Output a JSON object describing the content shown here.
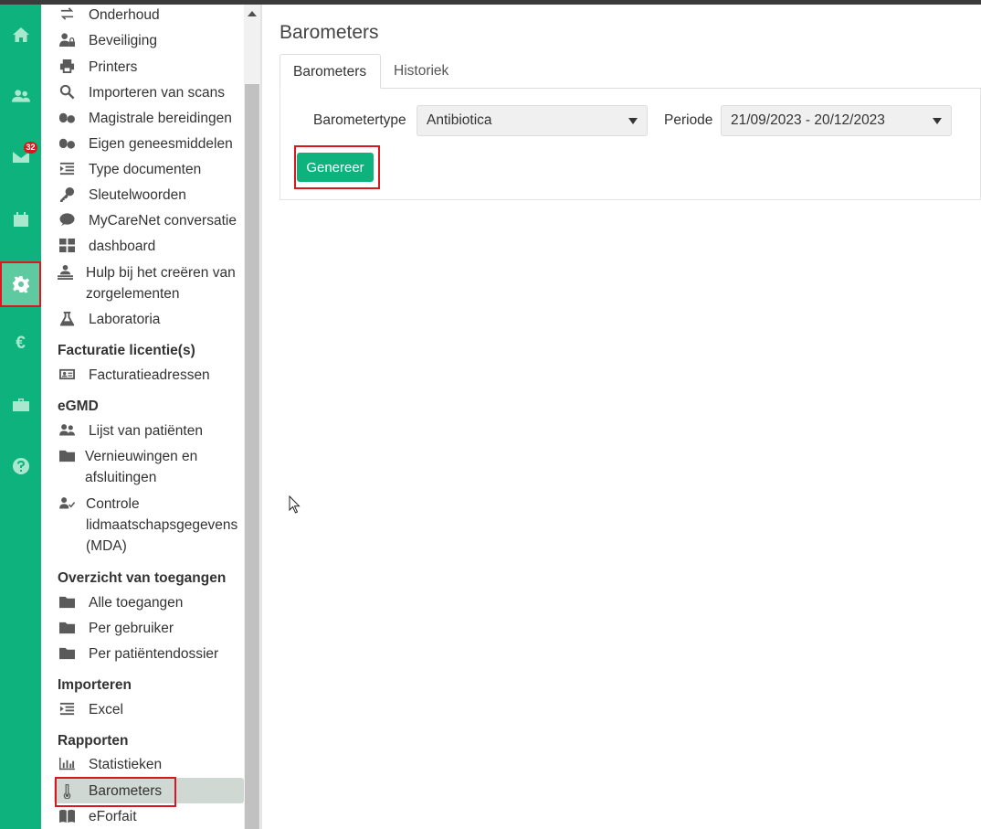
{
  "rail": {
    "mail_badge": "32",
    "euro_symbol": "€",
    "items": [
      "home-icon",
      "users-icon",
      "mail-icon",
      "calendar-icon",
      "gear-icon",
      "euro-icon",
      "briefcase-icon",
      "help-icon"
    ],
    "active": "gear-icon"
  },
  "sidebar": {
    "items": [
      {
        "label": "Onderhoud",
        "icon": "swap-icon"
      },
      {
        "label": "Beveiliging",
        "icon": "user-lock-icon"
      },
      {
        "label": "Printers",
        "icon": "printer-icon"
      },
      {
        "label": "Importeren van scans",
        "icon": "search-icon"
      },
      {
        "label": "Magistrale bereidingen",
        "icon": "pills-icon"
      },
      {
        "label": "Eigen geneesmiddelen",
        "icon": "pills-icon"
      },
      {
        "label": "Type documenten",
        "icon": "list-indent-icon"
      },
      {
        "label": "Sleutelwoorden",
        "icon": "key-icon"
      },
      {
        "label": "MyCareNet conversatie",
        "icon": "chat-icon"
      },
      {
        "label": "dashboard",
        "icon": "grid-icon"
      },
      {
        "label": "Hulp bij het creëren van",
        "label2": "zorgelementen",
        "icon": "help-care-icon"
      },
      {
        "label": "Laboratoria",
        "icon": "flask-icon"
      }
    ],
    "sections": {
      "facturatie": "Facturatie licentie(s)",
      "egmd": "eGMD",
      "toegangen": "Overzicht van toegangen",
      "importeren": "Importeren",
      "rapporten": "Rapporten"
    },
    "facturatie_items": [
      {
        "label": "Facturatieadressen",
        "icon": "id-card-icon"
      }
    ],
    "egmd_items": [
      {
        "label": "Lijst van patiënten",
        "icon": "users-icon"
      },
      {
        "label": "Vernieuwingen en",
        "label2": "afsluitingen",
        "icon": "folder-icon"
      },
      {
        "label": "Controle",
        "label2": "lidmaatschapsgegevens",
        "label3": "(MDA)",
        "icon": "user-check-icon"
      }
    ],
    "toegangen_items": [
      {
        "label": "Alle toegangen",
        "icon": "folder-icon"
      },
      {
        "label": "Per gebruiker",
        "icon": "folder-icon"
      },
      {
        "label": "Per patiëntendossier",
        "icon": "folder-icon"
      }
    ],
    "importeren_items": [
      {
        "label": "Excel",
        "icon": "list-indent-icon"
      }
    ],
    "rapporten_items": [
      {
        "label": "Statistieken",
        "icon": "bar-chart-icon"
      },
      {
        "label": "Barometers",
        "icon": "thermometer-icon",
        "selected": true
      },
      {
        "label": "eForfait",
        "icon": "book-icon"
      }
    ]
  },
  "main": {
    "title": "Barometers",
    "tabs": [
      {
        "label": "Barometers",
        "active": true
      },
      {
        "label": "Historiek",
        "active": false
      }
    ],
    "form": {
      "type_label": "Barometertype",
      "type_value": "Antibiotica",
      "period_label": "Periode",
      "period_value": "21/09/2023 - 20/12/2023",
      "generate_label": "Genereer"
    }
  },
  "colors": {
    "rail": "#0db27c",
    "accent": "#0db27c",
    "highlight": "#d9181e",
    "selected_item": "#cfd8d2"
  }
}
